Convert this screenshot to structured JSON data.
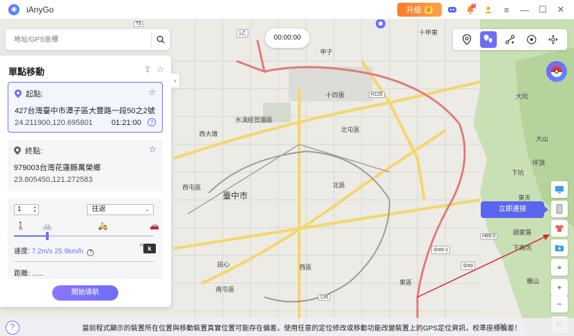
{
  "app": {
    "title": "iAnyGo",
    "upgrade_label": "升級",
    "notification_count": "1"
  },
  "search": {
    "placeholder": "地址/GPS坐標"
  },
  "panel": {
    "title": "單點移動",
    "start": {
      "label": "起點:",
      "address": "427台灣臺中市潭子區大豐路一段50之2號",
      "coords": "24.211900,120.695801",
      "time": "01:21:00"
    },
    "end": {
      "label": "終點:",
      "address": "979003台灣花蓮縣萬榮鄉",
      "coords": "23.805450,121.272583"
    },
    "repeat_count": "1",
    "route_mode": "往返",
    "speed_label": "速度:",
    "speed_value": "7.2m/s 25.9km/h",
    "unit_label": "k",
    "distance_label": "距離:",
    "distance_value": "......",
    "speed_level": 0.24,
    "start_button": "開始導航"
  },
  "timer": "00:00:00",
  "map": {
    "labels": [
      {
        "text": "臺中市",
        "big": true,
        "cls": "l-tcc"
      },
      {
        "text": "北屯區",
        "big": false,
        "cls": "l-bt"
      },
      {
        "text": "北區",
        "big": false,
        "cls": "l-bei"
      },
      {
        "text": "西屯區",
        "big": false,
        "cls": "l-xt"
      },
      {
        "text": "西大墩",
        "big": false,
        "cls": "l-xdd"
      },
      {
        "text": "西區",
        "big": false,
        "cls": "l-xi"
      },
      {
        "text": "東區",
        "big": false,
        "cls": "l-dong"
      },
      {
        "text": "南屯區",
        "big": false,
        "cls": "l-nt"
      },
      {
        "text": "田心",
        "big": false,
        "cls": "l-tx"
      },
      {
        "text": "水湳經貿園區",
        "big": false,
        "cls": "l-sn"
      },
      {
        "text": "十四張",
        "big": false,
        "cls": "l-ssz"
      },
      {
        "text": "大坑",
        "big": false,
        "cls": "l-dk"
      },
      {
        "text": "大山",
        "big": false,
        "cls": "l-ds"
      },
      {
        "text": "坪頂",
        "big": false,
        "cls": "l-pd"
      },
      {
        "text": "東天",
        "big": false,
        "cls": "l-dt"
      },
      {
        "text": "下坑",
        "big": false,
        "cls": "l-xk"
      },
      {
        "text": "頭家厝",
        "big": false,
        "cls": "l-tjc"
      },
      {
        "text": "下南坑",
        "big": false,
        "cls": "l-xnk"
      },
      {
        "text": "橫山",
        "big": false,
        "cls": "l-hs"
      },
      {
        "text": "十甲東",
        "big": false,
        "cls": "l-sjd"
      },
      {
        "text": "甲子",
        "big": false,
        "cls": "l-jz"
      }
    ],
    "roads": [
      {
        "text": "1乙",
        "cls": "r-1y"
      },
      {
        "text": "H126",
        "cls": "r-h126"
      },
      {
        "text": "136",
        "cls": "r-136"
      },
      {
        "text": "H89-3",
        "cls": "r-h893"
      },
      {
        "text": "中89-2",
        "cls": "r-h892"
      },
      {
        "text": "中89",
        "cls": "r-h89"
      },
      {
        "text": "T6",
        "cls": "r-t6"
      }
    ]
  },
  "connect_tip": "立即連接",
  "bottom_notice": "當前程式顯示的裝置所在位置與移動裝置真實位置可能存在偏差，使用任意的定位修改或移動功能改變裝置上的GPS定位資訊，校準座標偏差！",
  "colors": {
    "accent": "#6b6ff7",
    "upgrade": "#ff8a2a"
  }
}
